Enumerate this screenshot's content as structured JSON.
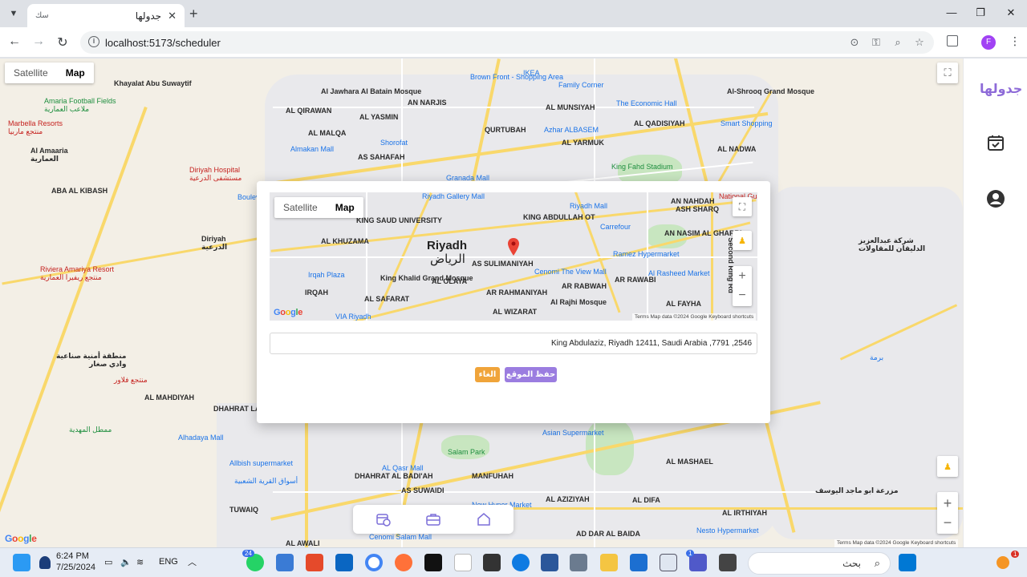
{
  "browser": {
    "tab_title": "جدولها",
    "tab_favicon": "سك",
    "url": "localhost:5173/scheduler",
    "profile_initial": "F"
  },
  "map": {
    "map_type_satellite": "Satellite",
    "map_type_map": "Map",
    "google": "Google",
    "attribution": "Terms   Map data ©2024 Google   Keyboard shortcuts",
    "labels": [
      {
        "text": "Khayalat Abu Suwaytif",
        "cls": "place"
      },
      {
        "text": "Amaria Football Fields\nملاعب العمارية",
        "cls": "green"
      },
      {
        "text": "Marbella Resorts\nمنتجع ماربيا",
        "cls": "red"
      },
      {
        "text": "Al Amaaria\nالعمارية",
        "cls": "place"
      },
      {
        "text": "ABA AL KIBASH",
        "cls": "place"
      },
      {
        "text": "Diriyah Hospital\nمستشفى الدرعية",
        "cls": "red"
      },
      {
        "text": "Diriyah\nالدرعية",
        "cls": "place"
      },
      {
        "text": "Riviera Amariya Resort\nمنتجع ريفيرا العمارية",
        "cls": "red"
      },
      {
        "text": "Al Jawhara Al Batain Mosque",
        "cls": "place"
      },
      {
        "text": "Brown Front - Shopping Area",
        "cls": "poi"
      },
      {
        "text": "IKEA",
        "cls": "poi"
      },
      {
        "text": "Family Corner",
        "cls": "poi"
      },
      {
        "text": "The Economic Hall",
        "cls": "poi"
      },
      {
        "text": "Al-Shrooq Grand Mosque",
        "cls": "place"
      },
      {
        "text": "Smart Shopping",
        "cls": "poi"
      },
      {
        "text": "AL NADWA",
        "cls": "place"
      },
      {
        "text": "Almakan Mall",
        "cls": "poi"
      },
      {
        "text": "Shorofat",
        "cls": "poi"
      },
      {
        "text": "Azhar ALBASEM",
        "cls": "poi"
      },
      {
        "text": "King Fahd Stadium",
        "cls": "green"
      },
      {
        "text": "Granada Mall",
        "cls": "poi"
      },
      {
        "text": "Boulev",
        "cls": "poi"
      },
      {
        "text": "منطقة أمنية صناعية\nوادي صغار",
        "cls": "place"
      },
      {
        "text": "منتجع فلاور",
        "cls": "red"
      },
      {
        "text": "AL MAHDIYAH",
        "cls": "place"
      },
      {
        "text": "DHAHRAT LAB",
        "cls": "place"
      },
      {
        "text": "ممطل المهدية",
        "cls": "green"
      },
      {
        "text": "Alhadaya Mall",
        "cls": "poi"
      },
      {
        "text": "Allbish supermarket",
        "cls": "poi"
      },
      {
        "text": "أسواق القرية الشعبية",
        "cls": "poi"
      },
      {
        "text": "TUWAIQ",
        "cls": "place"
      },
      {
        "text": "DHAHRAT AL BADI'AH",
        "cls": "place"
      },
      {
        "text": "AS SUWAIDI",
        "cls": "place"
      },
      {
        "text": "AL Qasr Mall",
        "cls": "poi"
      },
      {
        "text": "Salam Park",
        "cls": "green"
      },
      {
        "text": "MANFUHAH",
        "cls": "place"
      },
      {
        "text": "Asian Supermarket",
        "cls": "poi"
      },
      {
        "text": "AL MASHAEL",
        "cls": "place"
      },
      {
        "text": "AL AZIZIYAH",
        "cls": "place"
      },
      {
        "text": "Cenomi Salam Mall",
        "cls": "poi"
      },
      {
        "text": "New Hyper Market",
        "cls": "poi"
      },
      {
        "text": "AL DIFA",
        "cls": "place"
      },
      {
        "text": "AD DAR AL BAIDA",
        "cls": "place"
      },
      {
        "text": "Nesto Hypermarket",
        "cls": "poi"
      },
      {
        "text": "AL IRTHIYAH",
        "cls": "place"
      },
      {
        "text": "مزرعة ابو ماجد اليوسف",
        "cls": "place"
      },
      {
        "text": "AL AWALI",
        "cls": "place"
      },
      {
        "text": "شركة عبدالعزيز\nالدليقان للمقاولات",
        "cls": "place"
      },
      {
        "text": "برمة",
        "cls": "poi"
      },
      {
        "text": "AL QIRAWAN",
        "cls": "place"
      },
      {
        "text": "AL YASMIN",
        "cls": "place"
      },
      {
        "text": "AN NARJIS",
        "cls": "place"
      },
      {
        "text": "AL MALQA",
        "cls": "place"
      },
      {
        "text": "AS SAHAFAH",
        "cls": "place"
      },
      {
        "text": "AL MUNSIYAH",
        "cls": "place"
      },
      {
        "text": "AL QADISIYAH",
        "cls": "place"
      },
      {
        "text": "QURTUBAH",
        "cls": "place"
      },
      {
        "text": "AL YARMUK",
        "cls": "place"
      }
    ]
  },
  "modal": {
    "map_type_satellite": "Satellite",
    "map_type_map": "Map",
    "google": "Google",
    "attribution": "Terms   Map data ©2024 Google   Keyboard shortcuts",
    "city_en": "Riyadh",
    "city_ar": "الرياض",
    "address": "King Abdulaziz, Riyadh 12411, Saudi Arabia ,7791 ,2546",
    "save_label": "حفظ الموقع",
    "cancel_label": "الغاء",
    "labels": [
      {
        "text": "Riyadh Gallery Mall"
      },
      {
        "text": "KING SAUD UNIVERSITY"
      },
      {
        "text": "KING ABDULLAH OT"
      },
      {
        "text": "Riyadh Mall"
      },
      {
        "text": "Carrefour"
      },
      {
        "text": "National Gua"
      },
      {
        "text": "AN NAHDAH"
      },
      {
        "text": "ASH SHARQ"
      },
      {
        "text": "AL KHUZAMA"
      },
      {
        "text": "AS SULIMANIYAH"
      },
      {
        "text": "Cenomi The View Mall"
      },
      {
        "text": "Ramez Hypermarket"
      },
      {
        "text": "AN NASIM AL GHARBI"
      },
      {
        "text": "Irqah Plaza"
      },
      {
        "text": "King Khalid Grand Mosque"
      },
      {
        "text": "AL OLAYA"
      },
      {
        "text": "Al Rasheed Market"
      },
      {
        "text": "IRQAH"
      },
      {
        "text": "AL SAFARAT"
      },
      {
        "text": "AR RAHMANIYAH"
      },
      {
        "text": "AR RABWAH"
      },
      {
        "text": "AR RAWABI"
      },
      {
        "text": "Al Rajhi Mosque"
      },
      {
        "text": "AL FAYHA"
      },
      {
        "text": "VIA Riyadh"
      },
      {
        "text": "AL WIZARAT"
      },
      {
        "text": "Second Ring Rd"
      }
    ]
  },
  "sidebar": {
    "brand": "جدولها"
  },
  "taskbar": {
    "time": "6:24 PM",
    "date": "7/25/2024",
    "lang": "ENG",
    "search_placeholder": "بحث",
    "whatsapp_badge": "24",
    "teams_badge": "1",
    "notif_badge": "1"
  }
}
